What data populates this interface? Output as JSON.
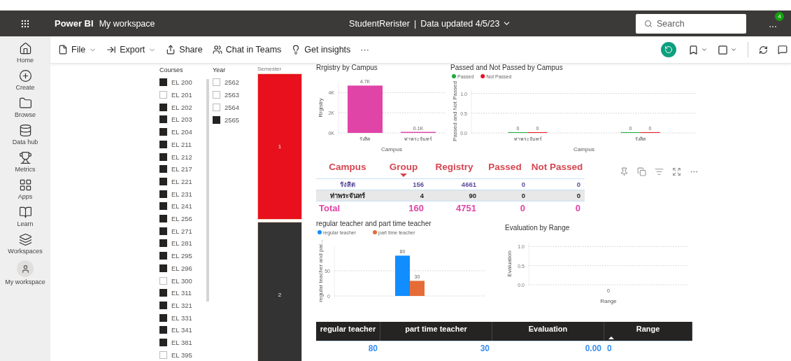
{
  "header": {
    "app": "Power BI",
    "workspace": "My workspace",
    "report": "StudentRerister",
    "separator": "|",
    "updated": "Data updated 4/5/23",
    "search": {
      "placeholder": "Search"
    },
    "more": "...",
    "notifications": "4"
  },
  "toolbar": {
    "items": [
      {
        "label": "File",
        "dropdown": true
      },
      {
        "label": "Export",
        "dropdown": true
      },
      {
        "label": "Share",
        "dropdown": false
      },
      {
        "label": "Chat in Teams",
        "dropdown": false
      },
      {
        "label": "Get insights",
        "dropdown": false
      }
    ],
    "overflow": "···"
  },
  "nav": [
    {
      "label": "Home"
    },
    {
      "label": "Create"
    },
    {
      "label": "Browse"
    },
    {
      "label": "Data hub"
    },
    {
      "label": "Metrics"
    },
    {
      "label": "Apps"
    },
    {
      "label": "Learn"
    },
    {
      "label": "Workspaces"
    },
    {
      "label": "My workspace"
    }
  ],
  "slicers": [
    {
      "title": "Courses",
      "scroll": true,
      "items": [
        {
          "label": "EL 200",
          "checked": true
        },
        {
          "label": "EL 201",
          "checked": false
        },
        {
          "label": "EL 202",
          "checked": true
        },
        {
          "label": "EL 203",
          "checked": true
        },
        {
          "label": "EL 204",
          "checked": true
        },
        {
          "label": "EL 211",
          "checked": true
        },
        {
          "label": "EL 212",
          "checked": true
        },
        {
          "label": "EL 217",
          "checked": true
        },
        {
          "label": "EL 221",
          "checked": true
        },
        {
          "label": "EL 231",
          "checked": true
        },
        {
          "label": "EL 241",
          "checked": true
        },
        {
          "label": "EL 256",
          "checked": true
        },
        {
          "label": "EL 271",
          "checked": true
        },
        {
          "label": "EL 281",
          "checked": true
        },
        {
          "label": "EL 295",
          "checked": true
        },
        {
          "label": "EL 296",
          "checked": true
        },
        {
          "label": "EL 300",
          "checked": false
        },
        {
          "label": "EL 311",
          "checked": true
        },
        {
          "label": "EL 321",
          "checked": true
        },
        {
          "label": "EL 331",
          "checked": true
        },
        {
          "label": "EL 341",
          "checked": true
        },
        {
          "label": "EL 381",
          "checked": true
        },
        {
          "label": "EL 395",
          "checked": false
        }
      ]
    },
    {
      "title": "Year",
      "scroll": false,
      "items": [
        {
          "label": "2562",
          "checked": false
        },
        {
          "label": "2563",
          "checked": false
        },
        {
          "label": "2564",
          "checked": false
        },
        {
          "label": "2565",
          "checked": true
        }
      ]
    }
  ],
  "semester": {
    "title": "Semester",
    "segments": [
      {
        "label": "1",
        "color": "#e8101c"
      },
      {
        "label": "2",
        "color": "#333333"
      }
    ]
  },
  "registry_chart": {
    "chart_data": {
      "type": "bar",
      "title": "Rrgistry by Campus",
      "xlabel": "Campus",
      "ylabel": "Rrgistry",
      "categories": [
        "รังสิต",
        "ท่าพระจันทร์"
      ],
      "series": [
        {
          "color": "#e044a7",
          "values": [
            4700,
            100
          ]
        }
      ],
      "ylim": [
        0,
        5000
      ],
      "yticks": [
        {
          "value": 0,
          "label": "0K"
        },
        {
          "value": 2000,
          "label": "2K"
        },
        {
          "value": 4000,
          "label": "4K"
        }
      ],
      "value_labels": [
        [
          "4.7K",
          "0.1K"
        ]
      ]
    }
  },
  "pass_chart": {
    "chart_data": {
      "type": "bar",
      "title": "Passed and Not Passed by Campus",
      "xlabel": "Campus",
      "ylabel": "Passed and Not Passed",
      "legend": true,
      "categories": [
        "ท่าพระจันทร์",
        "รังสิต"
      ],
      "series": [
        {
          "name": "Passed",
          "color": "#1aab40",
          "values": [
            0,
            0
          ]
        },
        {
          "name": "Not Passed",
          "color": "#e81123",
          "values": [
            0,
            0
          ]
        }
      ],
      "ylim": [
        0,
        1.1
      ],
      "yticks": [
        {
          "value": 0,
          "label": "0.0"
        },
        {
          "value": 0.5,
          "label": "0.5"
        },
        {
          "value": 1,
          "label": "1.0"
        }
      ],
      "data_labels": true
    }
  },
  "campus_table": {
    "columns": [
      {
        "label": "Campus",
        "sorted": false
      },
      {
        "label": "Group",
        "sorted": true
      },
      {
        "label": "Registry",
        "sorted": false
      },
      {
        "label": "Passed",
        "sorted": false
      },
      {
        "label": "Not Passed",
        "sorted": false
      }
    ],
    "rows": [
      [
        "รังสิต",
        "156",
        "4661",
        "0",
        "0"
      ],
      [
        "ท่าพระจันทร์",
        "4",
        "90",
        "0",
        "0"
      ]
    ],
    "total": [
      "Total",
      "160",
      "4751",
      "0",
      "0"
    ]
  },
  "teacher_chart": {
    "chart_data": {
      "type": "bar",
      "title": "regular teacher and part time teacher",
      "ylabel": "regular teacher and par...",
      "legend": true,
      "series": [
        {
          "name": "regular teacher",
          "color": "#118dff",
          "values": [
            80
          ]
        },
        {
          "name": "part time teacher",
          "color": "#e66c37",
          "values": [
            30
          ]
        }
      ],
      "ylim": [
        0,
        100
      ],
      "yticks": [
        0,
        50
      ],
      "data_labels": true
    }
  },
  "evaluation_chart": {
    "chart_data": {
      "type": "bar",
      "title": "Evaluation by Range",
      "xlabel": "Range",
      "ylabel": "Evaluation",
      "categories": [
        "0"
      ],
      "ylim": [
        0,
        1.1
      ],
      "yticks": [
        {
          "value": 0,
          "label": "0.0"
        },
        {
          "value": 0.5,
          "label": "0.5"
        },
        {
          "value": 1,
          "label": "1.0"
        }
      ]
    }
  },
  "summary_table": {
    "columns": [
      {
        "label": "regular teacher",
        "sorted": false
      },
      {
        "label": "part time teacher",
        "sorted": false
      },
      {
        "label": "Evaluation",
        "sorted": false
      },
      {
        "label": "Range",
        "sorted": true
      }
    ],
    "row": [
      "80",
      "30",
      "0.00",
      "0"
    ]
  }
}
